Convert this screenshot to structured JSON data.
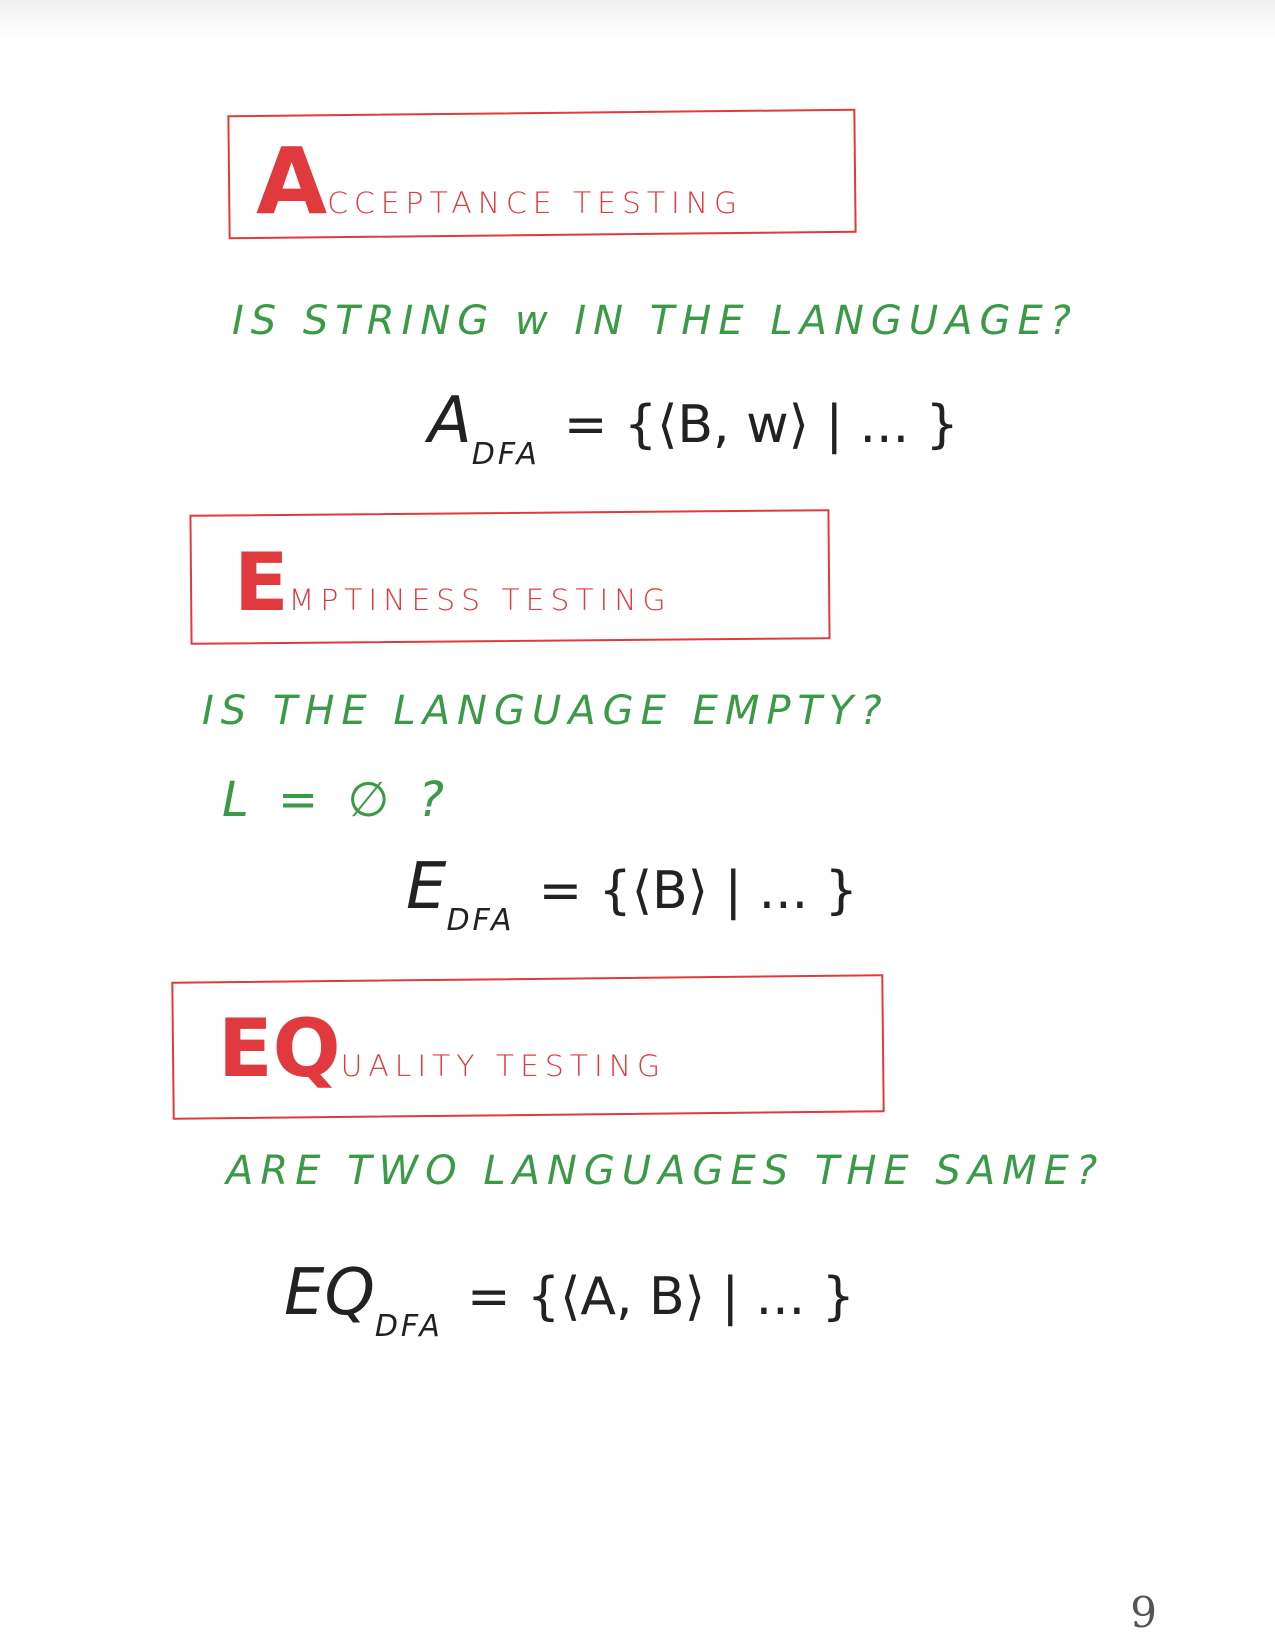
{
  "sections": [
    {
      "heading_cap": "A",
      "heading_rest": "CCEPTANCE TESTING",
      "question": "IS STRING w IN THE LANGUAGE?",
      "set_symbol": "A",
      "set_subscript": "DFA",
      "set_definition": "= {⟨B, w⟩ | ... }"
    },
    {
      "heading_cap": "E",
      "heading_rest": "MPTINESS TESTING",
      "question": "IS THE LANGUAGE EMPTY?",
      "question_line2": "L = ∅ ?",
      "set_symbol": "E",
      "set_subscript": "DFA",
      "set_definition": "= {⟨B⟩ | ... }"
    },
    {
      "heading_cap": "EQ",
      "heading_rest": "UALITY TESTING",
      "question": "ARE TWO LANGUAGES THE SAME?",
      "set_symbol": "EQ",
      "set_subscript": "DFA",
      "set_definition": "= {⟨A, B⟩ | ... }"
    }
  ],
  "page_number": "9",
  "colors": {
    "heading": "#e0393e",
    "question": "#3a9a46",
    "math": "#222222"
  }
}
